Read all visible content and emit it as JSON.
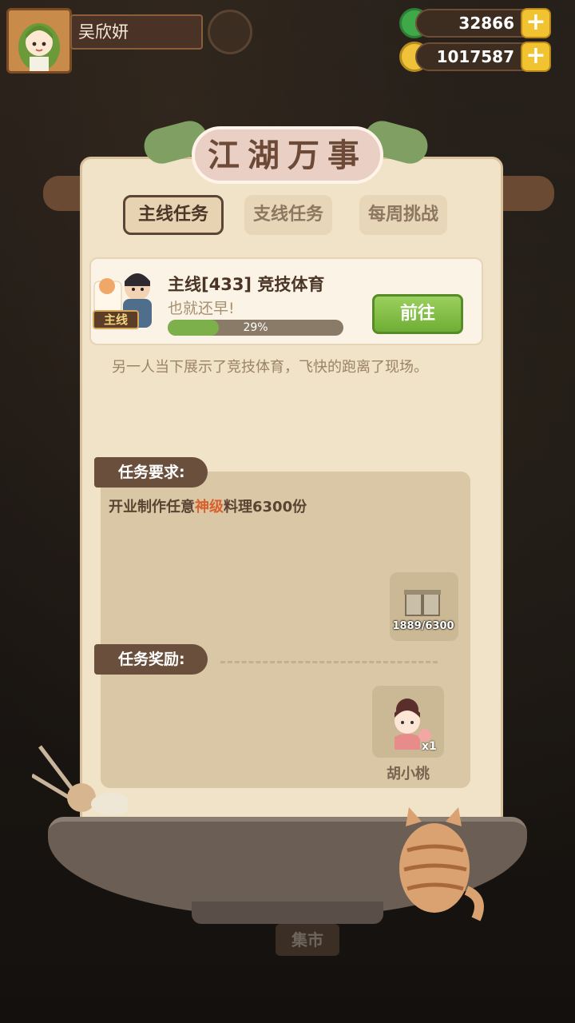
{
  "player": {
    "name": "吴欣妍",
    "currency_green": "32866",
    "currency_coin": "1017587"
  },
  "panel": {
    "title": "江湖万事",
    "tabs": [
      {
        "label": "主线任务",
        "active": true
      },
      {
        "label": "支线任务",
        "active": false
      },
      {
        "label": "每周挑战",
        "active": false
      }
    ]
  },
  "quest": {
    "tag": "主线",
    "title": "主线[433] 竞技体育",
    "subtitle": "也就还早!",
    "progress_percent": 29,
    "progress_label": "29%",
    "goto_label": "前往",
    "description": "另一人当下展示了竞技体育，飞快的跑离了现场。"
  },
  "requirement": {
    "header": "任务要求:",
    "text_before": "开业制作任意",
    "text_highlight": "神级",
    "text_after": "料理6300份",
    "item_count": "1889/6300"
  },
  "reward": {
    "header": "任务奖励:",
    "item_name": "胡小桃",
    "item_qty": "x1"
  },
  "bottom": {
    "market_label": "集市"
  },
  "colors": {
    "panel_bg": "#f1e3c8",
    "accent_green": "#7bb04b",
    "highlight_orange": "#d8612d",
    "section_tab": "#6a4f3c"
  }
}
